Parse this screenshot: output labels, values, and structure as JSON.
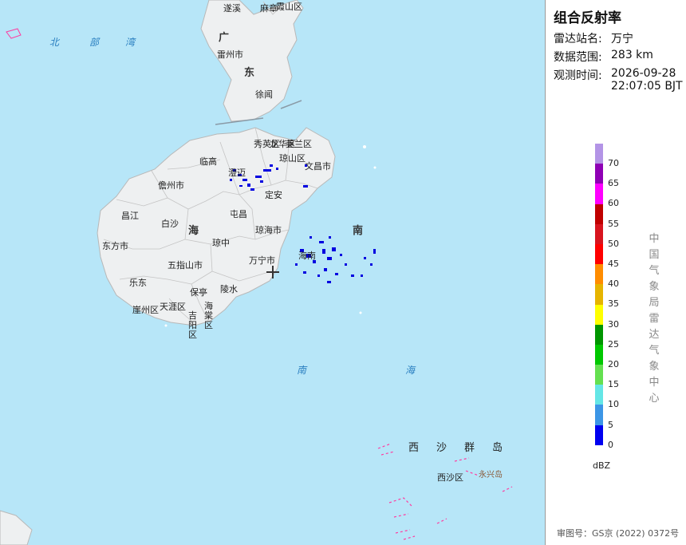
{
  "panel": {
    "title": "组合反射率",
    "station_label": "雷达站名:",
    "station_value": "万宁",
    "range_label": "数据范围:",
    "range_value": "283 km",
    "time_label": "观测时间:",
    "time_date": "2026-09-28",
    "time_clock": "22:07:05 BJT",
    "unit": "dBZ",
    "source_vertical": "中国气象局雷达气象中心",
    "approval": "审图号：GS京 (2022) 0372号"
  },
  "legend": {
    "ticks": [
      "70",
      "65",
      "60",
      "55",
      "50",
      "45",
      "40",
      "35",
      "30",
      "25",
      "20",
      "15",
      "10",
      "5",
      "0"
    ],
    "colors": [
      "#b394e6",
      "#8f00b5",
      "#ff00ff",
      "#c00000",
      "#d8141e",
      "#ff0000",
      "#ff8c00",
      "#e6b400",
      "#ffff00",
      "#009600",
      "#00c800",
      "#64e050",
      "#64e6e6",
      "#3c96e6",
      "#0000f0"
    ]
  },
  "map": {
    "seas": [
      "北",
      "部",
      "湾",
      "南",
      "海",
      "南",
      "海"
    ],
    "provinces": [
      "广",
      "东",
      "海",
      "南"
    ],
    "cities": {
      "suixi": "遂溪",
      "pocket": "麻章",
      "xiashan": "霞山区",
      "leizhou": "雷州市",
      "xuwen": "徐闻",
      "lingao": "临高",
      "xiuying": "秀英区",
      "longhua": "龙华区",
      "meilan": "美兰区",
      "qiongshan": "琼山区",
      "chengmai": "澄迈",
      "dingan": "定安",
      "wenchang": "文昌市",
      "danzhou": "儋州市",
      "changjiang": "昌江",
      "baisha": "白沙",
      "tunchang": "屯昌",
      "dongfang": "东方市",
      "qionghai": "琼海市",
      "qiongzhong": "琼中",
      "wuzhishan": "五指山市",
      "wanning": "万宁市",
      "ledong": "乐东",
      "baoting": "保亭",
      "lingshui": "陵水",
      "yazhou": "崖州区",
      "tianya": "天涯区",
      "jiyang": "吉阳区",
      "haitang": "海棠区",
      "xisha": "西沙区",
      "yongxing": "永兴岛",
      "hainan_short": "海南"
    },
    "xisha_group": "西沙群岛"
  }
}
